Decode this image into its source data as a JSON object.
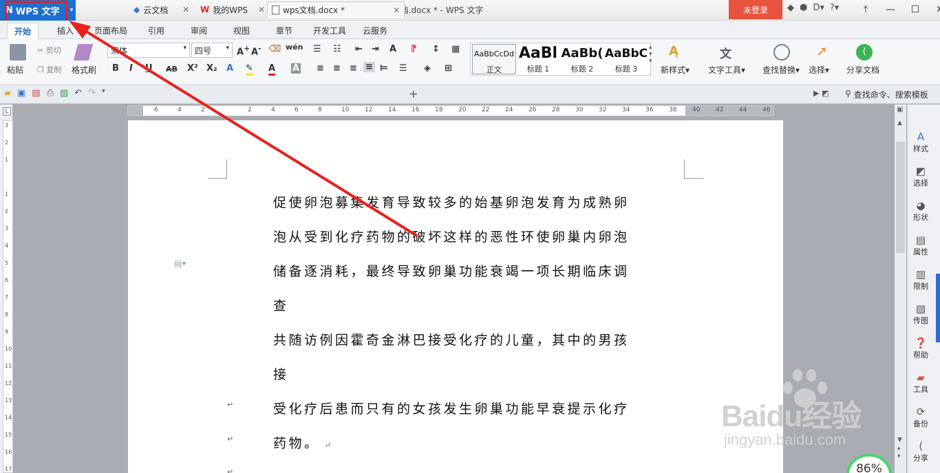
{
  "app": {
    "name": "WPS 文字",
    "doc_title": "wps文档.docx * - WPS 文字",
    "login": "未登录"
  },
  "menu_tabs": [
    "开始",
    "插入",
    "页面布局",
    "引用",
    "审阅",
    "视图",
    "章节",
    "开发工具",
    "云服务"
  ],
  "ribbon": {
    "clipboard": {
      "paste": "粘贴",
      "cut": "剪切",
      "copy": "复制",
      "format_painter": "格式刷"
    },
    "font": {
      "family": "宋体",
      "size": "四号"
    },
    "styles": [
      {
        "sample": "AaBbCcDd",
        "label": "正文"
      },
      {
        "sample": "AaBl",
        "label": "标题 1"
      },
      {
        "sample": "AaBb(",
        "label": "标题 2"
      },
      {
        "sample": "AaBbC",
        "label": "标题 3"
      }
    ],
    "new_style": "新样式",
    "text_tools": "文字工具",
    "find_replace": "查找替换",
    "select": "选择",
    "share": "分享文档"
  },
  "doc_tabs": [
    "云文档",
    "我的WPS",
    "wps文档.docx *"
  ],
  "search_placeholder": "查找命令、搜索模板",
  "document": {
    "lines": [
      "促使卵泡募集发育导致较多的始基卵泡发育为成熟卵",
      "泡从受到化疗药物的破坏这样的恶性环使卵巢内卵泡",
      "储备逐消耗，最终导致卵巢功能衰竭一项长期临床调查",
      "共随访例因霍奇金淋巴接受化疗的儿童，其中的男孩接",
      "受化疗后患而只有的女孩发生卵巢功能早衰提示化疗",
      "药物。"
    ]
  },
  "ruler": {
    "h_ticks": [
      "6",
      "4",
      "2",
      "",
      "2",
      "4",
      "6",
      "8",
      "10",
      "12",
      "14",
      "16",
      "18",
      "20",
      "22",
      "24",
      "26",
      "28",
      "30",
      "32",
      "34",
      "36",
      "38",
      "40",
      "42",
      "44",
      "46"
    ],
    "v_ticks": [
      "3",
      "2",
      "1",
      "",
      "1",
      "2",
      "3",
      "4",
      "5",
      "6",
      "7",
      "8",
      "9",
      "10",
      "11",
      "12",
      "13",
      "14",
      "15",
      "16",
      "17"
    ]
  },
  "sidebar": [
    "样式",
    "选择",
    "形状",
    "属性",
    "限制",
    "传图",
    "帮助",
    "工具",
    "备份",
    "分享"
  ],
  "zoom": "86%",
  "watermark": {
    "brand": "Baidu经验",
    "url": "jingyan.baidu.com"
  },
  "colors": {
    "accent": "#1d6fd1",
    "login": "#e8533d",
    "annotation": "#e8211d"
  }
}
